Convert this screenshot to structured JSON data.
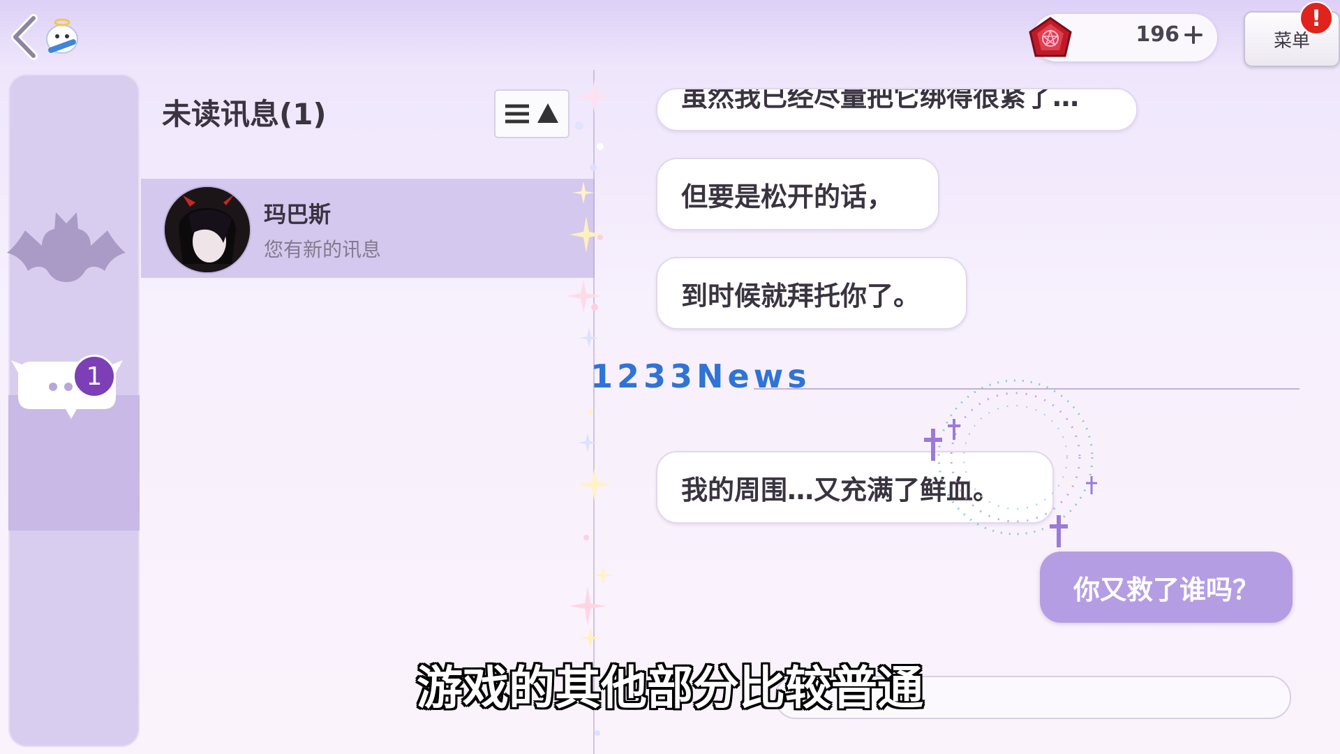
{
  "header": {
    "currency_value": "196",
    "menu_label": "菜单",
    "alert_mark": "!"
  },
  "sidebar": {
    "unread_badge": "1"
  },
  "message_list": {
    "title": "未读讯息(1)",
    "items": [
      {
        "name": "玛巴斯",
        "preview": "您有新的讯息"
      }
    ]
  },
  "chat": {
    "incoming": [
      "虽然我已经尽量把它绑得很紧了…",
      "但要是松开的话，",
      "到时候就拜托你了。",
      "我的周围…又充满了鲜血。"
    ],
    "outgoing": [
      "你又救了谁吗？"
    ]
  },
  "overlay": {
    "watermark": "1233News",
    "subtitle": "游戏的其他部分比较普通"
  },
  "colors": {
    "accent": "#b59de4",
    "badge": "#7c3fb6",
    "alert": "#e0231c"
  }
}
